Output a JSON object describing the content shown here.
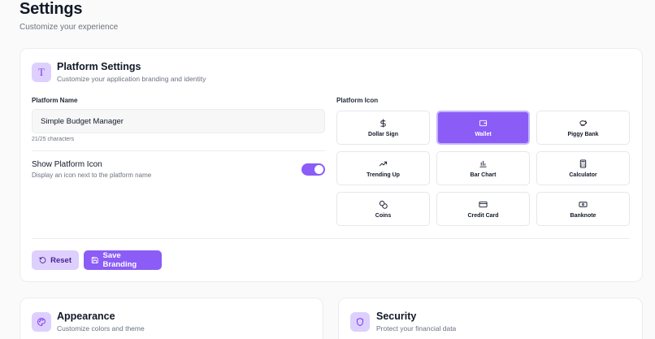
{
  "page": {
    "title": "Settings",
    "subtitle": "Customize your experience"
  },
  "platform": {
    "title": "Platform Settings",
    "subtitle": "Customize your application branding and identity",
    "header_icon": "T",
    "name_label": "Platform Name",
    "name_value": "Simple Budget Manager",
    "char_count": "21/25 characters",
    "show_icon_title": "Show Platform Icon",
    "show_icon_desc": "Display an icon next to the platform name",
    "show_icon_enabled": true,
    "icon_label": "Platform Icon",
    "icons": [
      {
        "label": "Dollar Sign",
        "icon": "dollar-sign-icon",
        "selected": false
      },
      {
        "label": "Wallet",
        "icon": "wallet-icon",
        "selected": true
      },
      {
        "label": "Piggy Bank",
        "icon": "piggy-bank-icon",
        "selected": false
      },
      {
        "label": "Trending Up",
        "icon": "trending-up-icon",
        "selected": false
      },
      {
        "label": "Bar Chart",
        "icon": "bar-chart-icon",
        "selected": false
      },
      {
        "label": "Calculator",
        "icon": "calculator-icon",
        "selected": false
      },
      {
        "label": "Coins",
        "icon": "coins-icon",
        "selected": false
      },
      {
        "label": "Credit Card",
        "icon": "credit-card-icon",
        "selected": false
      },
      {
        "label": "Banknote",
        "icon": "banknote-icon",
        "selected": false
      }
    ],
    "reset_label": "Reset",
    "save_label": "Save Branding"
  },
  "appearance": {
    "title": "Appearance",
    "subtitle": "Customize colors and theme",
    "icon": "palette-icon"
  },
  "security": {
    "title": "Security",
    "subtitle": "Protect your financial data",
    "icon": "shield-icon"
  },
  "colors": {
    "accent": "#8b5cf6",
    "accent_light": "#ddd0fe",
    "accent_border": "#c4b5fd"
  }
}
